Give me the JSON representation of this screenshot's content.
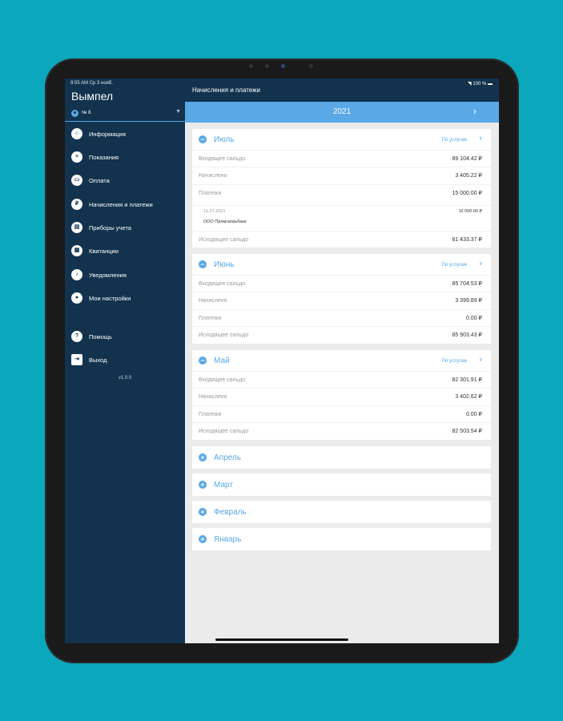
{
  "status": {
    "time": "9:55 AM",
    "date": "Ср 3 нояб.",
    "battery": "100 %"
  },
  "sidebar": {
    "app_title": "Вымпел",
    "account": "№ 8",
    "items": [
      {
        "label": "Информация",
        "icon": "house-icon"
      },
      {
        "label": "Показания",
        "icon": "meter-readings-icon"
      },
      {
        "label": "Оплата",
        "icon": "payment-icon"
      },
      {
        "label": "Начисления и платежи",
        "icon": "ruble-icon"
      },
      {
        "label": "Приборы учета",
        "icon": "device-icon"
      },
      {
        "label": "Квитанции",
        "icon": "receipt-icon"
      },
      {
        "label": "Уведомления",
        "icon": "bell-icon"
      },
      {
        "label": "Мои настройки",
        "icon": "settings-icon"
      }
    ],
    "help": "Помощь",
    "logout": "Выход",
    "version": "v1.0.0"
  },
  "header": {
    "title": "Начисления и платежи"
  },
  "year": "2021",
  "by_service_label": "По услугам",
  "months": [
    {
      "name": "Июль",
      "expanded": true,
      "rows": [
        {
          "label": "Входящее сальдо",
          "value": "89 104.42 ₽"
        },
        {
          "label": "Начислено",
          "value": "3 405.22 ₽"
        },
        {
          "label": "Платежи",
          "value": "15 000.00 ₽"
        }
      ],
      "payment": {
        "date": "15.07.2021",
        "amount": "15 000.00 ₽",
        "org": "ООО Промсвязьбанк"
      },
      "closing": {
        "label": "Исходящее сальдо",
        "value": "81 433.37 ₽"
      }
    },
    {
      "name": "Июнь",
      "expanded": true,
      "rows": [
        {
          "label": "Входящее сальдо",
          "value": "85 704.53 ₽"
        },
        {
          "label": "Начислено",
          "value": "3 399.89 ₽"
        },
        {
          "label": "Платежи",
          "value": "0.00 ₽"
        },
        {
          "label": "Исходящее сальдо",
          "value": "85 903.43 ₽"
        }
      ]
    },
    {
      "name": "Май",
      "expanded": true,
      "rows": [
        {
          "label": "Входящее сальдо",
          "value": "82 301.91 ₽"
        },
        {
          "label": "Начислено",
          "value": "3 402.62 ₽"
        },
        {
          "label": "Платежи",
          "value": "0.00 ₽"
        },
        {
          "label": "Исходящее сальдо",
          "value": "82 503.54 ₽"
        }
      ]
    },
    {
      "name": "Апрель",
      "expanded": false
    },
    {
      "name": "Март",
      "expanded": false
    },
    {
      "name": "Февраль",
      "expanded": false
    },
    {
      "name": "Январь",
      "expanded": false
    }
  ],
  "colors": {
    "accent": "#5aa8e6",
    "sidebar": "#12324d",
    "background": "#0aa7bd"
  }
}
